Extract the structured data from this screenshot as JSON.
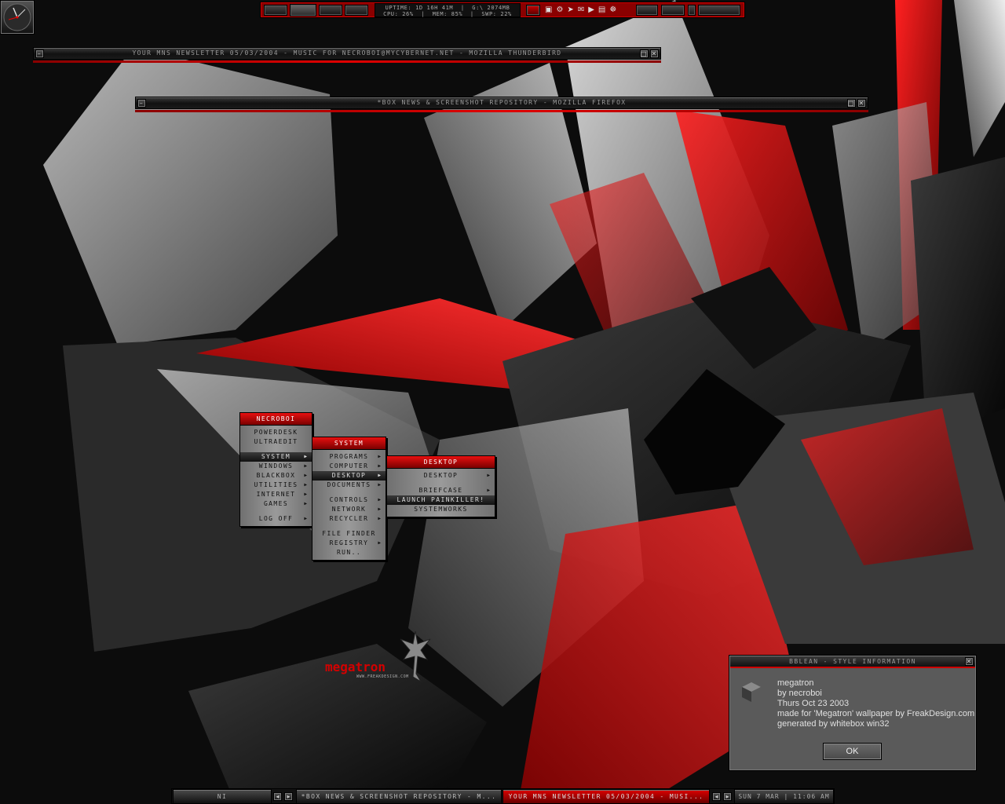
{
  "colors": {
    "accent": "#d40000",
    "dark": "#0a0a0a",
    "grey": "#8c8c8c"
  },
  "toolbar": {
    "stats_line1": "UPTIME: 1D 16H 41M  |  G:\\ 2074MB",
    "stats_line2": "CPU: 26%  |  MEM: 85%  |  SWP: 22%",
    "workspace_count": 4,
    "tray_icons": [
      "window-icon",
      "network-icon",
      "cursor-icon",
      "mail-icon",
      "play-icon",
      "text-icon",
      "gear-icon"
    ]
  },
  "windows": [
    {
      "id": "thunderbird",
      "title": "YOUR MNS NEWSLETTER 05/03/2004 - MUSIC FOR NECROBOI@MYCYBERNET.NET - MOZILLA THUNDERBIRD"
    },
    {
      "id": "firefox",
      "title": "*BOX NEWS & SCREENSHOT REPOSITORY - MOZILLA FIREFOX"
    }
  ],
  "menus": {
    "root": {
      "title": "NECROBOI",
      "items": [
        {
          "label": "POWERDESK"
        },
        {
          "label": "ULTRAEDIT"
        },
        {
          "gap": true
        },
        {
          "label": "SYSTEM",
          "sub": true,
          "selected": true
        },
        {
          "label": "WINDOWS",
          "sub": true
        },
        {
          "label": "BLACKBOX",
          "sub": true
        },
        {
          "label": "UTILITIES",
          "sub": true
        },
        {
          "label": "INTERNET",
          "sub": true
        },
        {
          "label": "GAMES",
          "sub": true
        },
        {
          "gap": true
        },
        {
          "label": "LOG OFF",
          "sub": true
        }
      ]
    },
    "system": {
      "title": "SYSTEM",
      "items": [
        {
          "label": "PROGRAMS",
          "sub": true
        },
        {
          "label": "COMPUTER",
          "sub": true
        },
        {
          "label": "DESKTOP",
          "sub": true,
          "selected": true
        },
        {
          "label": "DOCUMENTS",
          "sub": true
        },
        {
          "gap": true
        },
        {
          "label": "CONTROLS",
          "sub": true
        },
        {
          "label": "NETWORK",
          "sub": true
        },
        {
          "label": "RECYCLER",
          "sub": true
        },
        {
          "gap": true
        },
        {
          "label": "FILE FINDER"
        },
        {
          "label": "REGISTRY",
          "sub": true
        },
        {
          "label": "RUN.."
        }
      ]
    },
    "desktop": {
      "title": "DESKTOP",
      "items": [
        {
          "label": "DESKTOP",
          "sub": true
        },
        {
          "gap": true
        },
        {
          "label": "BRIEFCASE",
          "sub": true
        },
        {
          "label": "LAUNCH PAINKILLER!",
          "selected": true
        },
        {
          "label": "SYSTEMWORKS"
        }
      ]
    }
  },
  "logo": {
    "text": "megatron",
    "url": "WWW.FREAKDESIGN.COM"
  },
  "style_dialog": {
    "title": "BBLEAN - STYLE INFORMATION",
    "lines": [
      "megatron",
      "by necroboi",
      "Thurs Oct 23 2003",
      "made for 'Megatron' wallpaper by FreakDesign.com",
      "generated by whitebox win32"
    ],
    "ok": "OK"
  },
  "taskbar": {
    "workspace": "NI",
    "tasks": [
      {
        "label": "*BOX NEWS & SCREENSHOT REPOSITORY - M...",
        "active": false
      },
      {
        "label": "YOUR MNS NEWSLETTER 05/03/2004 - MUSI...",
        "active": true
      }
    ],
    "clock": "SUN 7 MAR | 11:06 AM"
  }
}
